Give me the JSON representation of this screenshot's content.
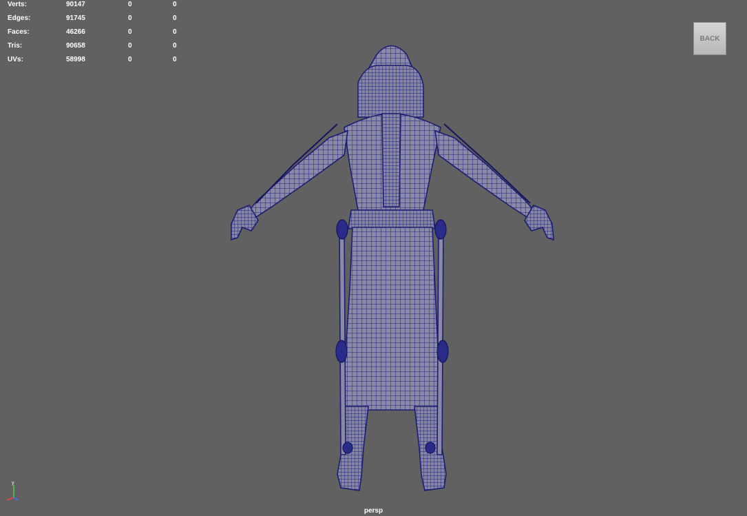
{
  "hud": {
    "rows": [
      {
        "label": "Verts:",
        "v1": "90147",
        "v2": "0",
        "v3": "0"
      },
      {
        "label": "Edges:",
        "v1": "91745",
        "v2": "0",
        "v3": "0"
      },
      {
        "label": "Faces:",
        "v1": "46266",
        "v2": "0",
        "v3": "0"
      },
      {
        "label": "Tris:",
        "v1": "90658",
        "v2": "0",
        "v3": "0"
      },
      {
        "label": "UVs:",
        "v1": "58998",
        "v2": "0",
        "v3": "0"
      }
    ]
  },
  "view_cube": {
    "label": "BACK"
  },
  "camera": {
    "name": "persp"
  },
  "axis": {
    "up_label": "y"
  },
  "colors": {
    "viewport_bg": "#616161",
    "wire": "#20207a",
    "surface": "#8a8aa8"
  }
}
